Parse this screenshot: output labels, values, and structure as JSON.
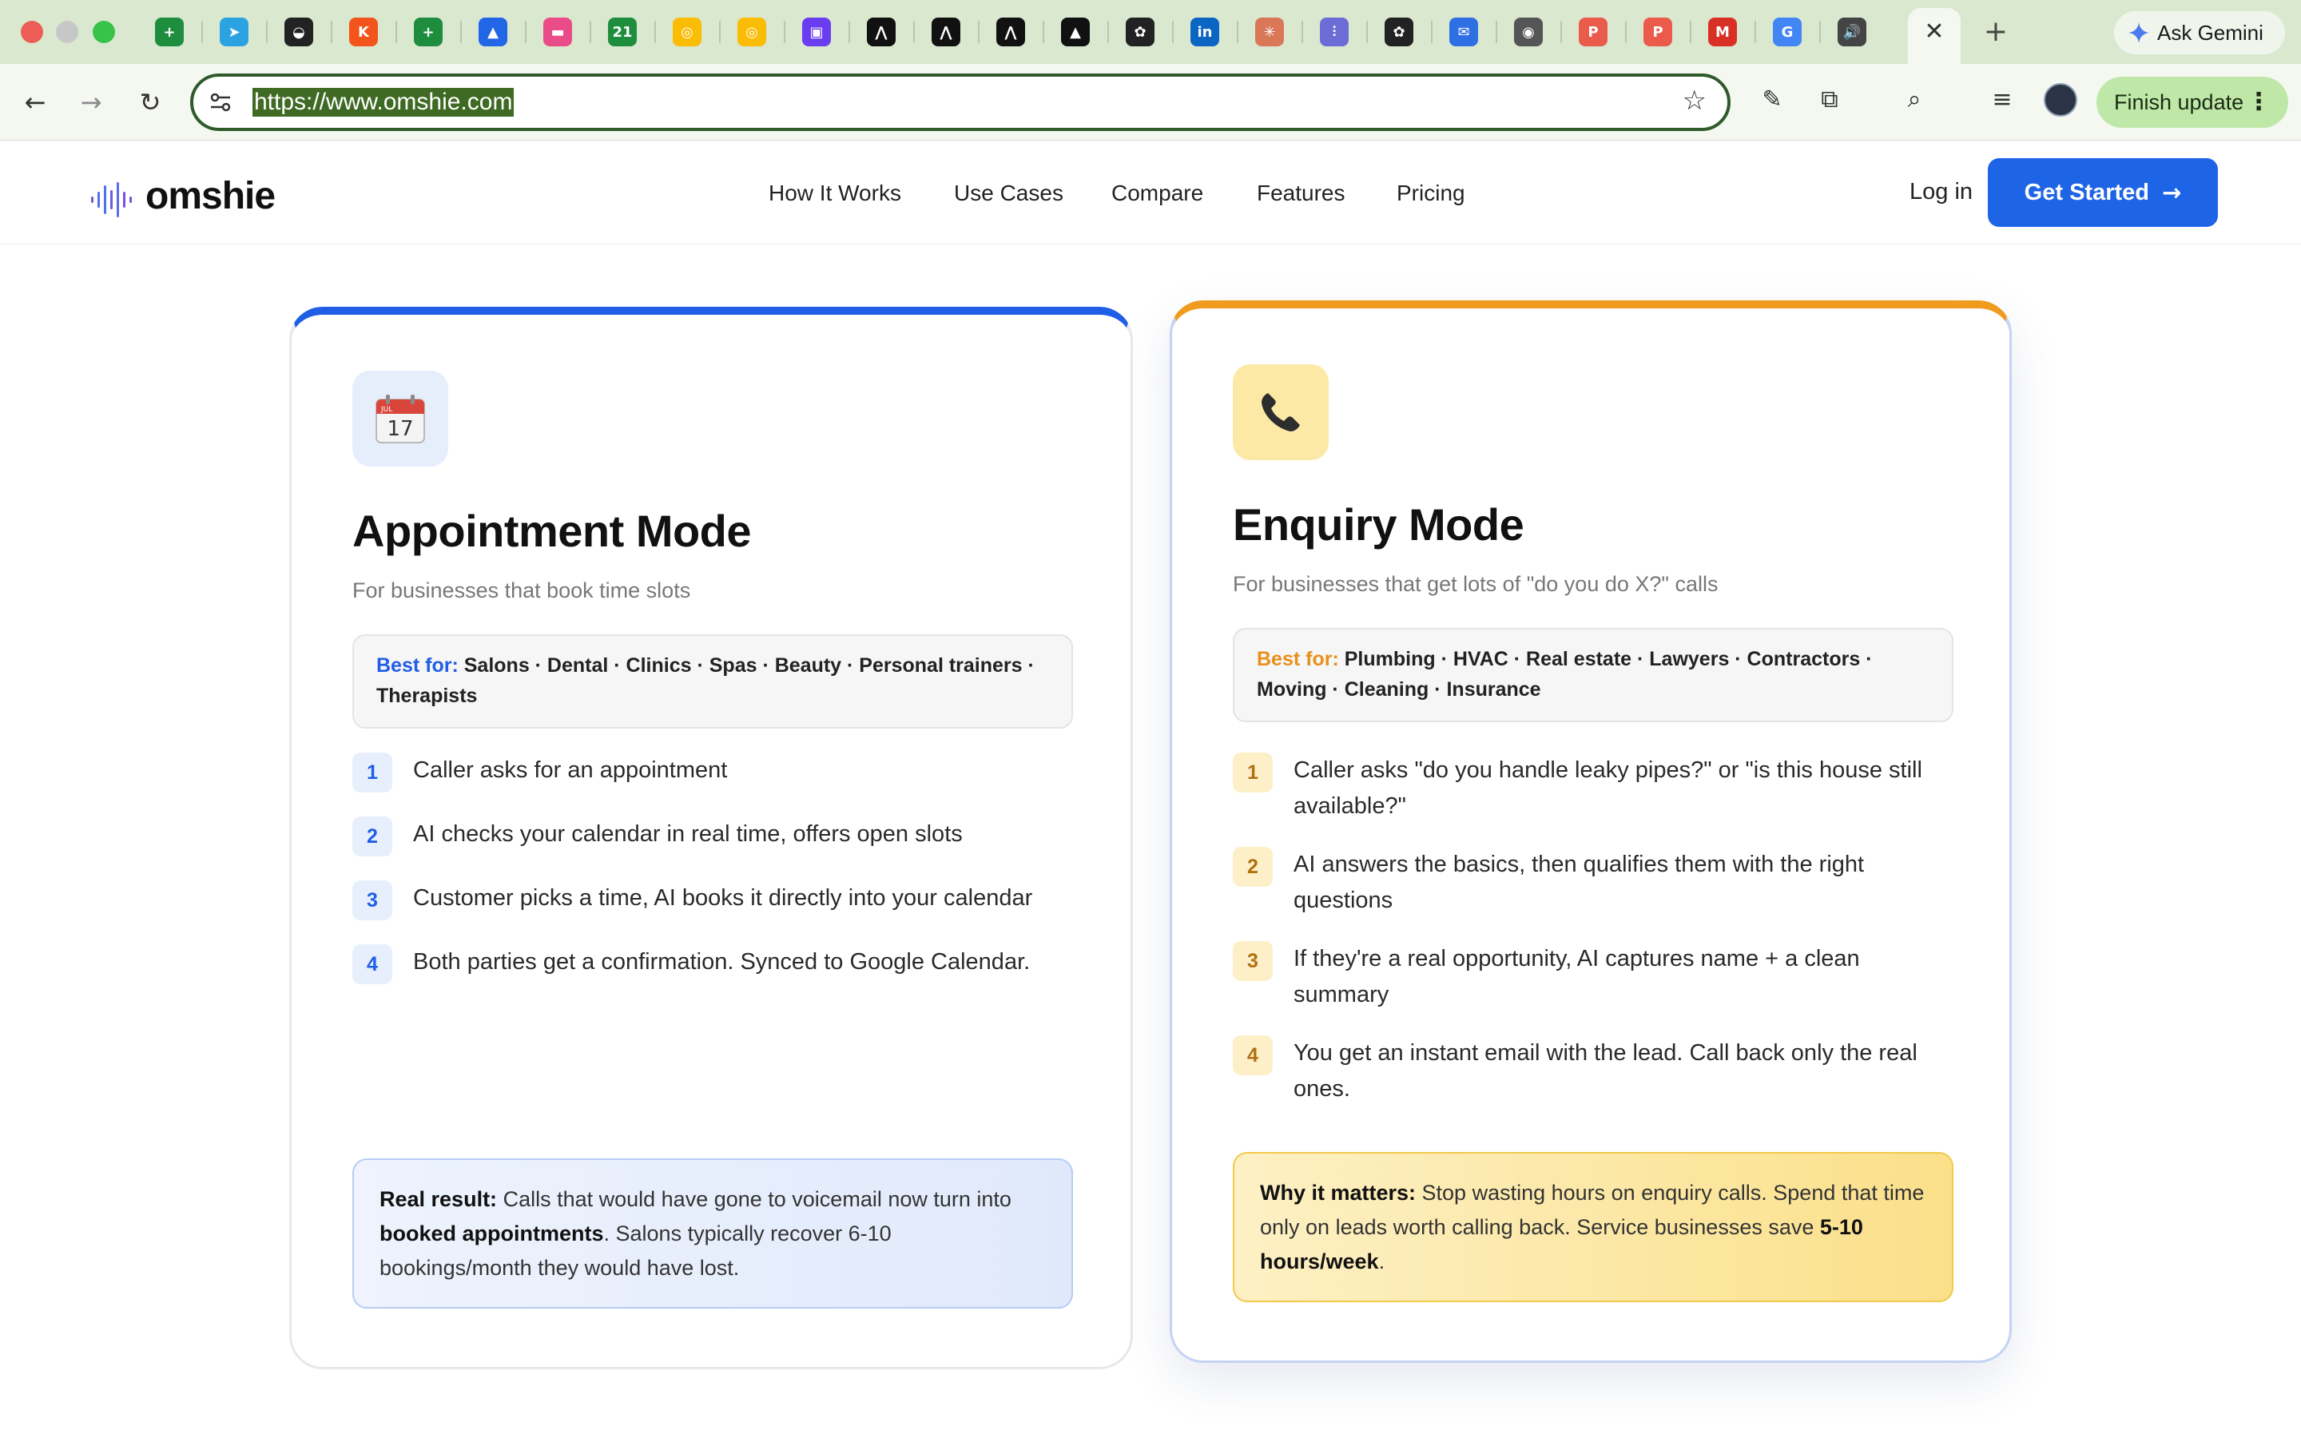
{
  "browser": {
    "url": "https://www.omshie.com",
    "ask_gemini": "Ask Gemini",
    "finish_update": "Finish update",
    "tabs": [
      {
        "icon": "sheets-icon",
        "color": "#1e8e3e",
        "glyph": "+"
      },
      {
        "icon": "telegram-icon",
        "color": "#2aa3e0",
        "glyph": "➤"
      },
      {
        "icon": "circle-face-icon",
        "color": "#222222",
        "glyph": "◒"
      },
      {
        "icon": "orange-app-icon",
        "color": "#f2541b",
        "glyph": "K"
      },
      {
        "icon": "sheets-icon",
        "color": "#1e8e3e",
        "glyph": "+"
      },
      {
        "icon": "atlassian-icon",
        "color": "#2266e8",
        "glyph": "▲"
      },
      {
        "icon": "pink-app-icon",
        "color": "#ea4c89",
        "glyph": "▬"
      },
      {
        "icon": "calendar-21-icon",
        "color": "#1e8e3e",
        "glyph": "21"
      },
      {
        "icon": "google-circle-icon",
        "color": "#fbbc04",
        "glyph": "◎"
      },
      {
        "icon": "google-circle-icon",
        "color": "#fbbc04",
        "glyph": "◎"
      },
      {
        "icon": "purple-app-icon",
        "color": "#6a3df0",
        "glyph": "▣"
      },
      {
        "icon": "stack-icon",
        "color": "#111111",
        "glyph": "⋀"
      },
      {
        "icon": "stack-icon",
        "color": "#111111",
        "glyph": "⋀"
      },
      {
        "icon": "stack-icon",
        "color": "#111111",
        "glyph": "⋀"
      },
      {
        "icon": "triangle-icon",
        "color": "#111111",
        "glyph": "▲"
      },
      {
        "icon": "openai-icon",
        "color": "#222222",
        "glyph": "✿"
      },
      {
        "icon": "linkedin-icon",
        "color": "#0a66c2",
        "glyph": "in"
      },
      {
        "icon": "claude-icon",
        "color": "#d97757",
        "glyph": "✳"
      },
      {
        "icon": "waveform-icon",
        "color": "#6c6cd6",
        "glyph": "⫶"
      },
      {
        "icon": "openai-icon",
        "color": "#222222",
        "glyph": "✿"
      },
      {
        "icon": "mail-icon",
        "color": "#2f6fe4",
        "glyph": "✉"
      },
      {
        "icon": "chrome-icon",
        "color": "#555555",
        "glyph": "◉"
      },
      {
        "icon": "producthunt-icon",
        "color": "#ea5b4c",
        "glyph": "P"
      },
      {
        "icon": "producthunt-icon",
        "color": "#ea5b4c",
        "glyph": "P"
      },
      {
        "icon": "gmail-icon",
        "color": "#d93025",
        "glyph": "M"
      },
      {
        "icon": "google-icon",
        "color": "#4285f4",
        "glyph": "G"
      },
      {
        "icon": "speaker-icon",
        "color": "#444444",
        "glyph": "🔊"
      }
    ]
  },
  "site": {
    "logo": "omshie",
    "nav": [
      "How It Works",
      "Use Cases",
      "Compare",
      "Features",
      "Pricing"
    ],
    "login": "Log in",
    "cta": "Get Started"
  },
  "cards": [
    {
      "accent": "#1f5ee6",
      "icon": "calendar-icon",
      "icon_month": "JUL",
      "icon_day": "17",
      "title": "Appointment Mode",
      "subtitle": "For businesses that book time slots",
      "bestfor_label": "Best for:",
      "bestfor_text": "Salons · Dental · Clinics · Spas · Beauty · Personal trainers · Therapists",
      "steps": [
        "Caller asks for an appointment",
        "AI checks your calendar in real time, offers open slots",
        "Customer picks a time, AI books it directly into your calendar",
        "Both parties get a confirmation. Synced to Google Calendar."
      ],
      "note": {
        "lead": "Real result:",
        "text1": " Calls that would have gone to voicemail now turn into ",
        "bold": "booked appointments",
        "text2": ". Salons typically recover 6-10 bookings/month they would have lost."
      }
    },
    {
      "accent": "#f09a1e",
      "icon": "phone-icon",
      "title": "Enquiry Mode",
      "subtitle": "For businesses that get lots of \"do you do X?\" calls",
      "bestfor_label": "Best for:",
      "bestfor_text": "Plumbing · HVAC · Real estate · Lawyers · Contractors · Moving · Cleaning · Insurance",
      "steps": [
        "Caller asks \"do you handle leaky pipes?\" or \"is this house still available?\"",
        "AI answers the basics, then qualifies them with the right questions",
        "If they're a real opportunity, AI captures name + a clean summary",
        "You get an instant email with the lead. Call back only the real ones."
      ],
      "note": {
        "lead": "Why it matters:",
        "text1": " Stop wasting hours on enquiry calls. Spend that time only on leads worth calling back. Service businesses save ",
        "bold": "5-10 hours/week",
        "text2": "."
      }
    }
  ]
}
